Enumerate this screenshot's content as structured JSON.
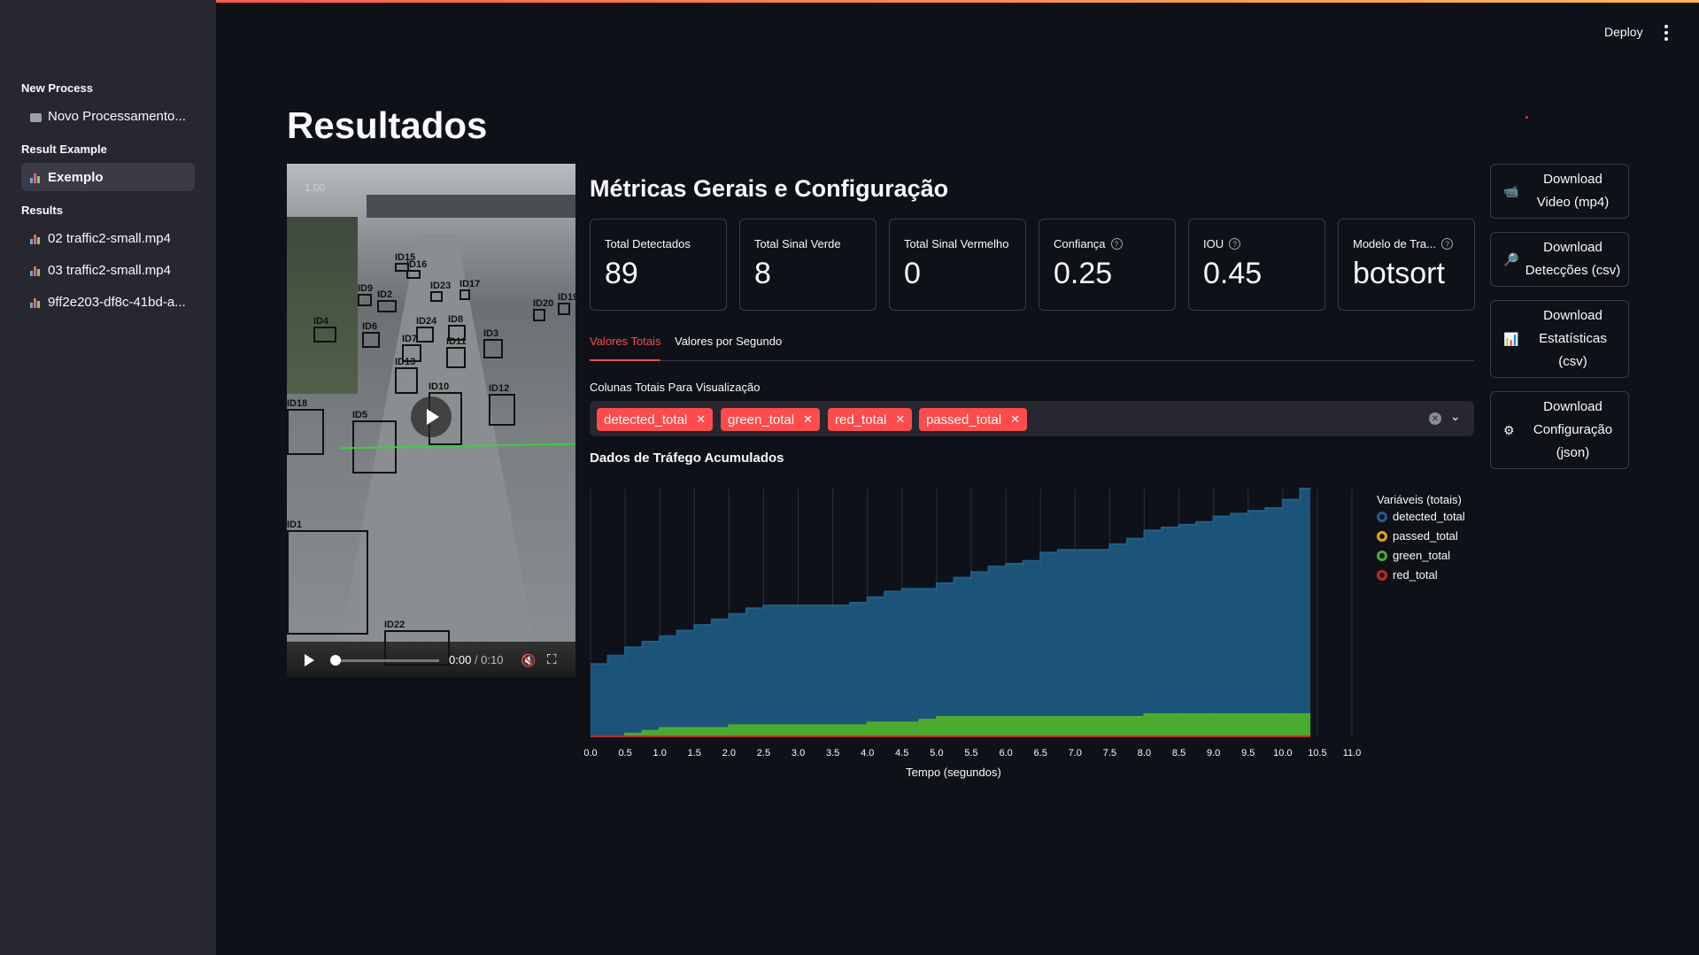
{
  "header": {
    "deploy_label": "Deploy"
  },
  "sidebar": {
    "sections": [
      {
        "title": "New Process",
        "items": [
          {
            "label": "Novo Processamento...",
            "icon": "camera-icon"
          }
        ]
      },
      {
        "title": "Result Example",
        "items": [
          {
            "label": "Exemplo",
            "icon": "bar-chart-icon",
            "active": true
          }
        ]
      },
      {
        "title": "Results",
        "items": [
          {
            "label": "02 traffic2-small.mp4",
            "icon": "bar-chart-icon"
          },
          {
            "label": "03 traffic2-small.mp4",
            "icon": "bar-chart-icon"
          },
          {
            "label": "9ff2e203-df8c-41bd-a...",
            "icon": "bar-chart-icon"
          }
        ]
      }
    ]
  },
  "main": {
    "title": "Resultados",
    "video": {
      "speed": "1.00",
      "time_current": "0:00",
      "time_total": "/ 0:10",
      "detections": [
        "ID15",
        "ID16",
        "ID9",
        "ID2",
        "ID23",
        "ID17",
        "ID20",
        "ID19",
        "ID4",
        "ID6",
        "ID24",
        "ID7",
        "ID11",
        "ID3",
        "ID5",
        "ID13",
        "ID10",
        "ID12",
        "ID18",
        "ID8",
        "ID1",
        "ID22"
      ]
    },
    "metrics_title": "Métricas Gerais e Configuração",
    "metrics": [
      {
        "label": "Total Detectados",
        "value": "89",
        "help": false
      },
      {
        "label": "Total Sinal Verde",
        "value": "8",
        "help": false
      },
      {
        "label": "Total Sinal Vermelho",
        "value": "0",
        "help": false
      },
      {
        "label": "Confiança",
        "value": "0.25",
        "help": true
      },
      {
        "label": "IOU",
        "value": "0.45",
        "help": true
      },
      {
        "label": "Modelo de Tra...",
        "value": "botsort",
        "help": true
      }
    ],
    "tabs": [
      {
        "label": "Valores Totais",
        "active": true
      },
      {
        "label": "Valores por Segundo",
        "active": false
      }
    ],
    "multiselect": {
      "label": "Colunas Totais Para Visualização",
      "chips": [
        "detected_total",
        "green_total",
        "red_total",
        "passed_total"
      ]
    },
    "chart_title": "Dados de Tráfego Acumulados",
    "downloads": [
      {
        "lines": [
          "Download",
          "Video (mp4)"
        ],
        "icon": "camera-icon"
      },
      {
        "lines": [
          "Download",
          "Detecções (csv)"
        ],
        "icon": "magnifier-icon"
      },
      {
        "lines": [
          "Download",
          "Estatísticas",
          "(csv)"
        ],
        "icon": "bar-chart-icon"
      },
      {
        "lines": [
          "Download",
          "Configuração",
          "(json)"
        ],
        "icon": "gear-icon"
      }
    ]
  },
  "colors": {
    "accent": "#ff4b4b",
    "detected": "#1f5f8b",
    "passed": "#e5a50a",
    "green": "#4caf2a",
    "red": "#c62828"
  },
  "chart_data": {
    "type": "area",
    "title": "",
    "xlabel": "Tempo (segundos)",
    "ylabel": "",
    "xlim": [
      0,
      11.0
    ],
    "x_ticks": [
      "0.0",
      "0.5",
      "1.0",
      "1.5",
      "2.0",
      "2.5",
      "3.0",
      "3.5",
      "4.0",
      "4.5",
      "5.0",
      "5.5",
      "6.0",
      "6.5",
      "7.0",
      "7.5",
      "8.0",
      "8.5",
      "9.0",
      "9.5",
      "10.0",
      "10.5",
      "11.0"
    ],
    "ylim": [
      0,
      89
    ],
    "legend": {
      "title": "Variáveis (totais)",
      "placement": "right",
      "entries": [
        "detected_total",
        "passed_total",
        "green_total",
        "red_total"
      ]
    },
    "x": [
      0.0,
      0.25,
      0.5,
      0.75,
      1.0,
      1.25,
      1.5,
      1.75,
      2.0,
      2.25,
      2.5,
      2.75,
      3.0,
      3.25,
      3.5,
      3.75,
      4.0,
      4.25,
      4.5,
      4.75,
      5.0,
      5.25,
      5.5,
      5.75,
      6.0,
      6.25,
      6.5,
      6.75,
      7.0,
      7.25,
      7.5,
      7.75,
      8.0,
      8.25,
      8.5,
      8.75,
      9.0,
      9.25,
      9.5,
      9.75,
      10.0,
      10.25,
      10.4
    ],
    "series": [
      {
        "name": "detected_total",
        "values": [
          26,
          29,
          32,
          34,
          36,
          38,
          40,
          42,
          44,
          46,
          47,
          47,
          47,
          47,
          47,
          48,
          50,
          52,
          53,
          53,
          55,
          57,
          59,
          61,
          62,
          63,
          66,
          67,
          67,
          67,
          69,
          71,
          74,
          75,
          76,
          77,
          79,
          80,
          81,
          82,
          85,
          89,
          89
        ]
      },
      {
        "name": "passed_total",
        "values": [
          0,
          0,
          0,
          0,
          0,
          0,
          0,
          0,
          0,
          0,
          0,
          0,
          0,
          0,
          0,
          0,
          0,
          0,
          0,
          0,
          0,
          0,
          0,
          0,
          0,
          0,
          0,
          0,
          0,
          0,
          0,
          0,
          0,
          0,
          0,
          0,
          0,
          0,
          0,
          0,
          0,
          0,
          0
        ]
      },
      {
        "name": "green_total",
        "values": [
          0,
          0,
          1,
          2,
          3,
          3,
          3,
          3,
          4,
          4,
          4,
          4,
          4,
          4,
          4,
          4,
          5,
          5,
          5,
          6,
          7,
          7,
          7,
          7,
          7,
          7,
          7,
          7,
          7,
          7,
          7,
          7,
          8,
          8,
          8,
          8,
          8,
          8,
          8,
          8,
          8,
          8,
          8
        ]
      },
      {
        "name": "red_total",
        "values": [
          0,
          0,
          0,
          0,
          0,
          0,
          0,
          0,
          0,
          0,
          0,
          0,
          0,
          0,
          0,
          0,
          0,
          0,
          0,
          0,
          0,
          0,
          0,
          0,
          0,
          0,
          0,
          0,
          0,
          0,
          0,
          0,
          0,
          0,
          0,
          0,
          0,
          0,
          0,
          0,
          0,
          0,
          0
        ]
      }
    ]
  }
}
